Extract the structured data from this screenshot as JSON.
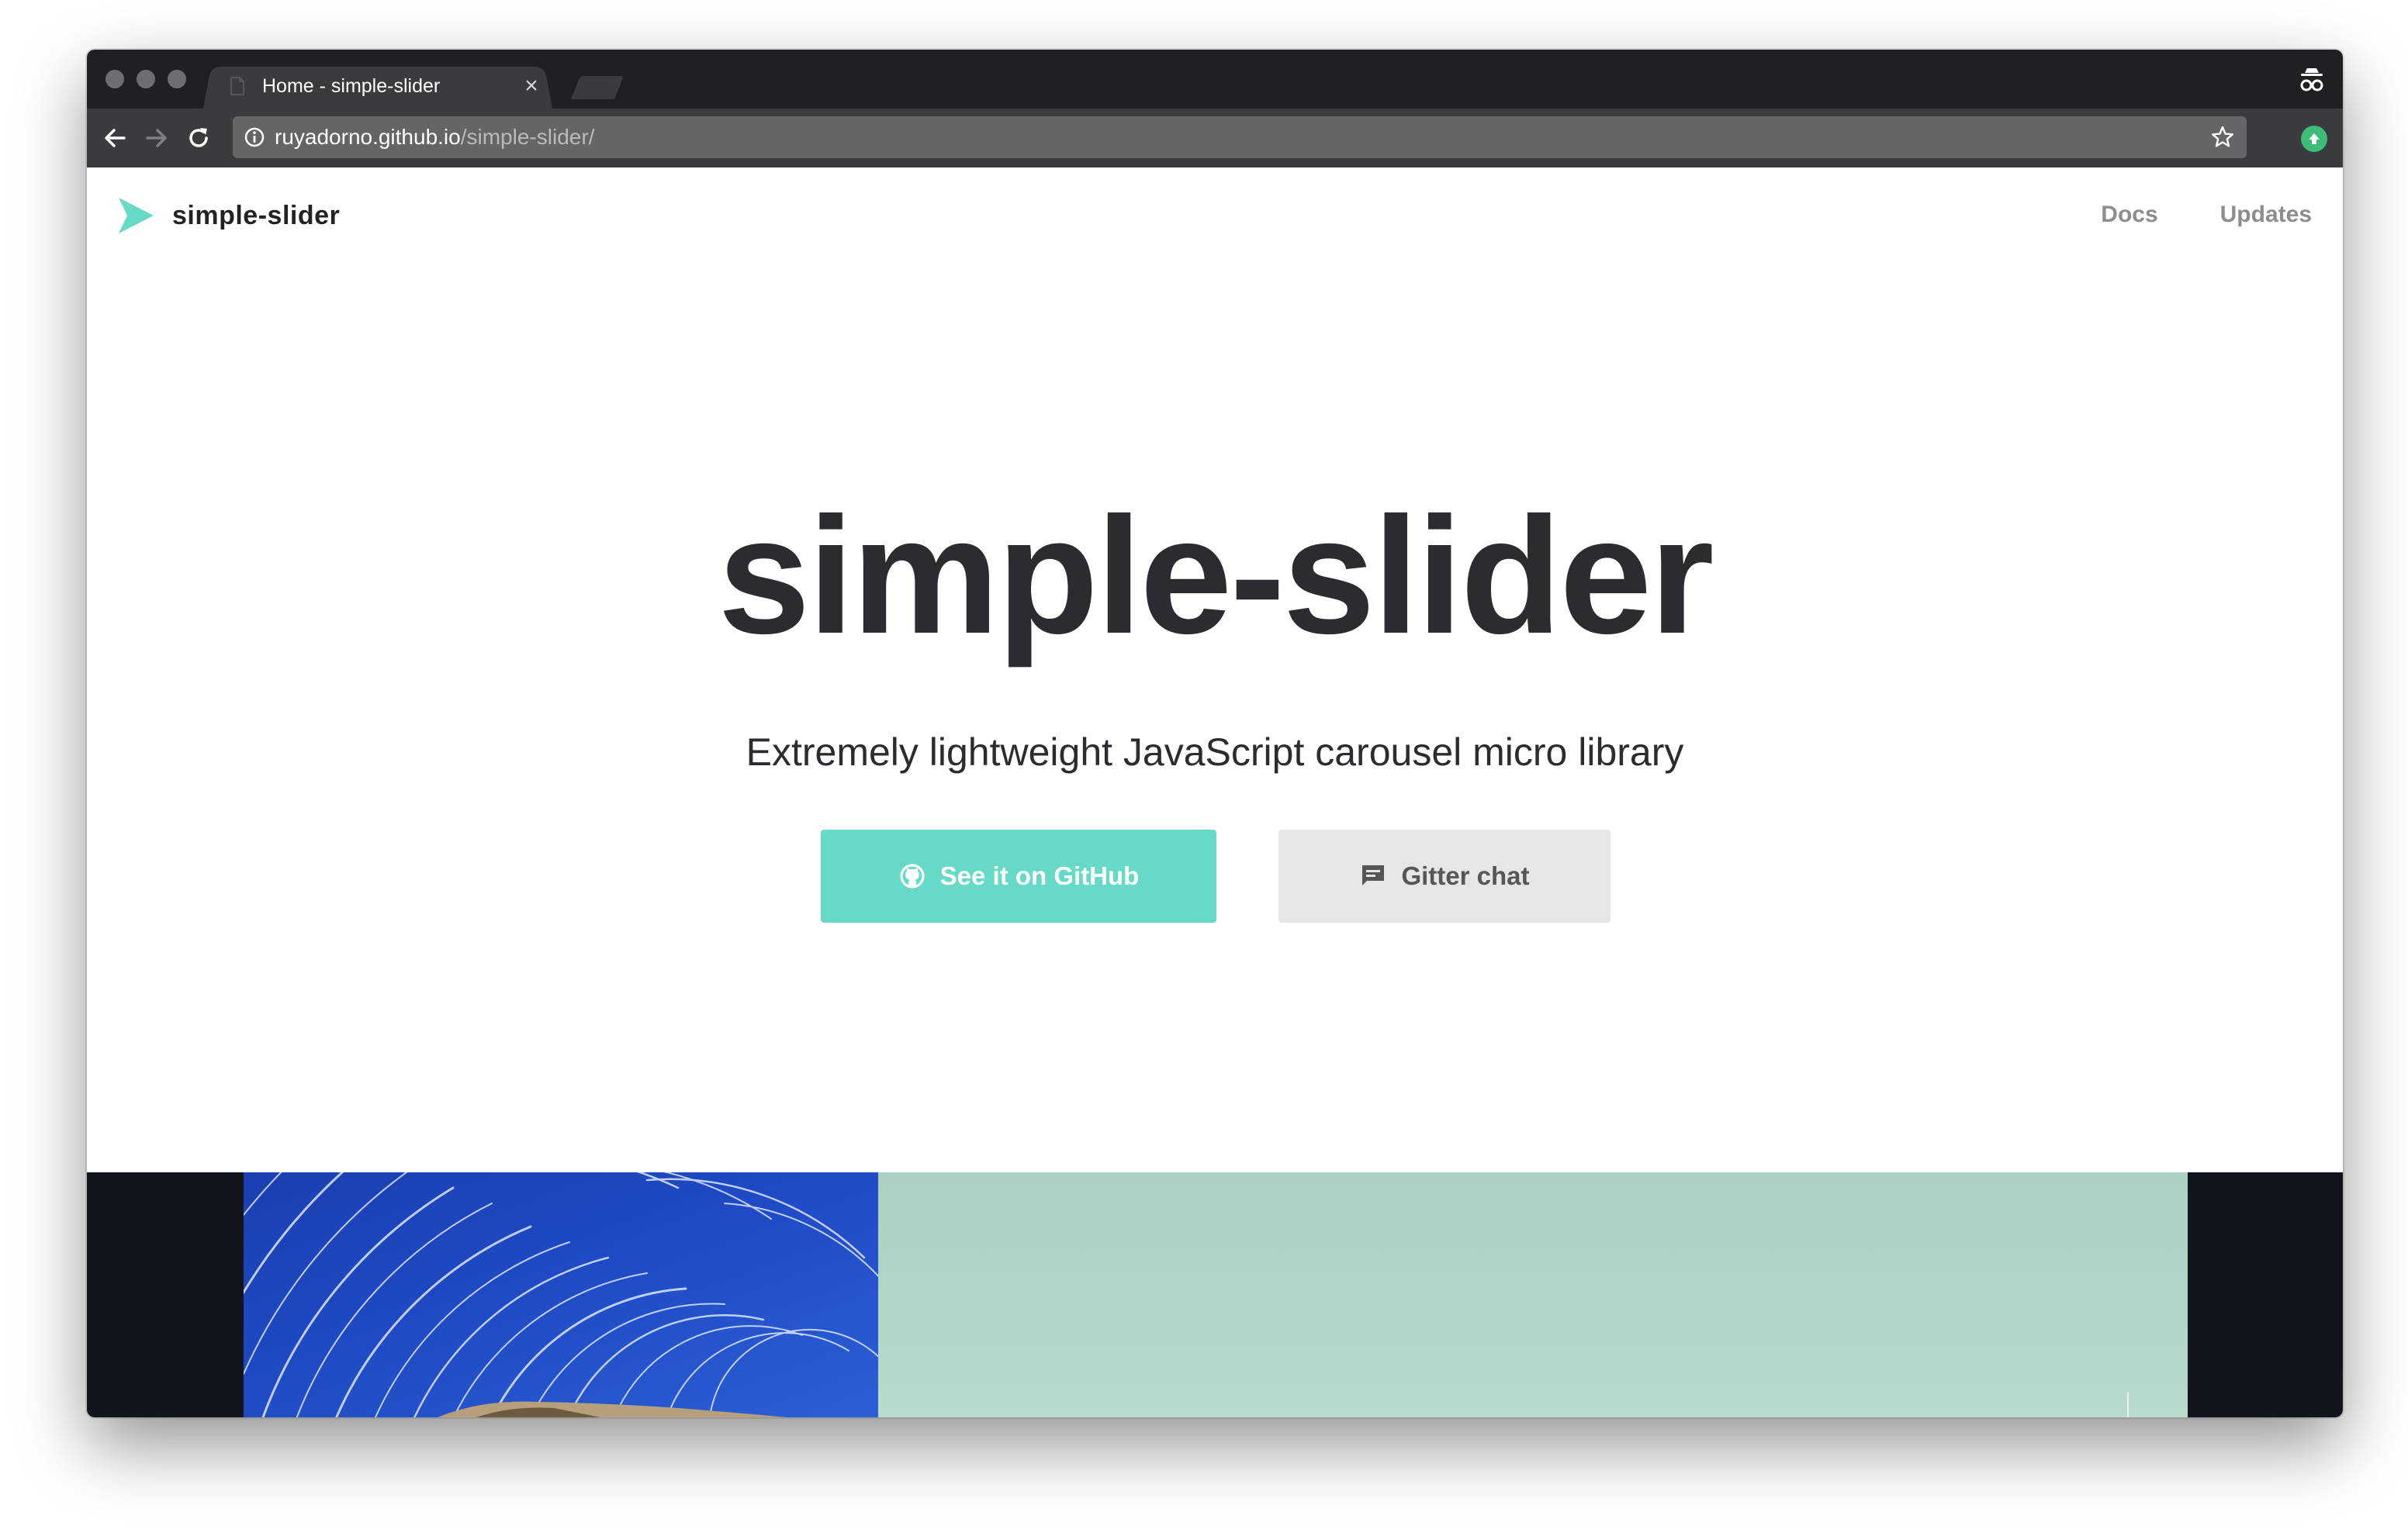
{
  "browser": {
    "tab": {
      "title": "Home - simple-slider",
      "close_glyph": "×"
    },
    "address_bar": {
      "host": "ruyadorno.github.io",
      "path": "/simple-slider/"
    },
    "icons": {
      "back": "back-arrow-icon",
      "forward": "forward-arrow-icon",
      "reload": "reload-icon",
      "info": "info-icon",
      "bookmark": "star-icon",
      "extension": "extension-update-icon",
      "incognito": "incognito-icon"
    }
  },
  "site": {
    "brand": {
      "name": "simple-slider"
    },
    "nav": [
      {
        "label": "Docs"
      },
      {
        "label": "Updates"
      }
    ],
    "hero": {
      "title": "simple-slider",
      "subtitle": "Extremely lightweight JavaScript carousel micro library"
    },
    "buttons": {
      "github": {
        "label": "See it on GitHub",
        "icon": "github-icon"
      },
      "gitter": {
        "label": "Gitter chat",
        "icon": "chat-icon"
      }
    }
  },
  "colors": {
    "accent": "#66d9c7",
    "text_dark": "#2b2c2f",
    "nav_link": "#8c8d90",
    "button_secondary": "#e5e6e7",
    "chrome_dark": "#1f2023",
    "chrome_toolbar": "#3a3b3e",
    "slider_bg": "#12161c"
  }
}
